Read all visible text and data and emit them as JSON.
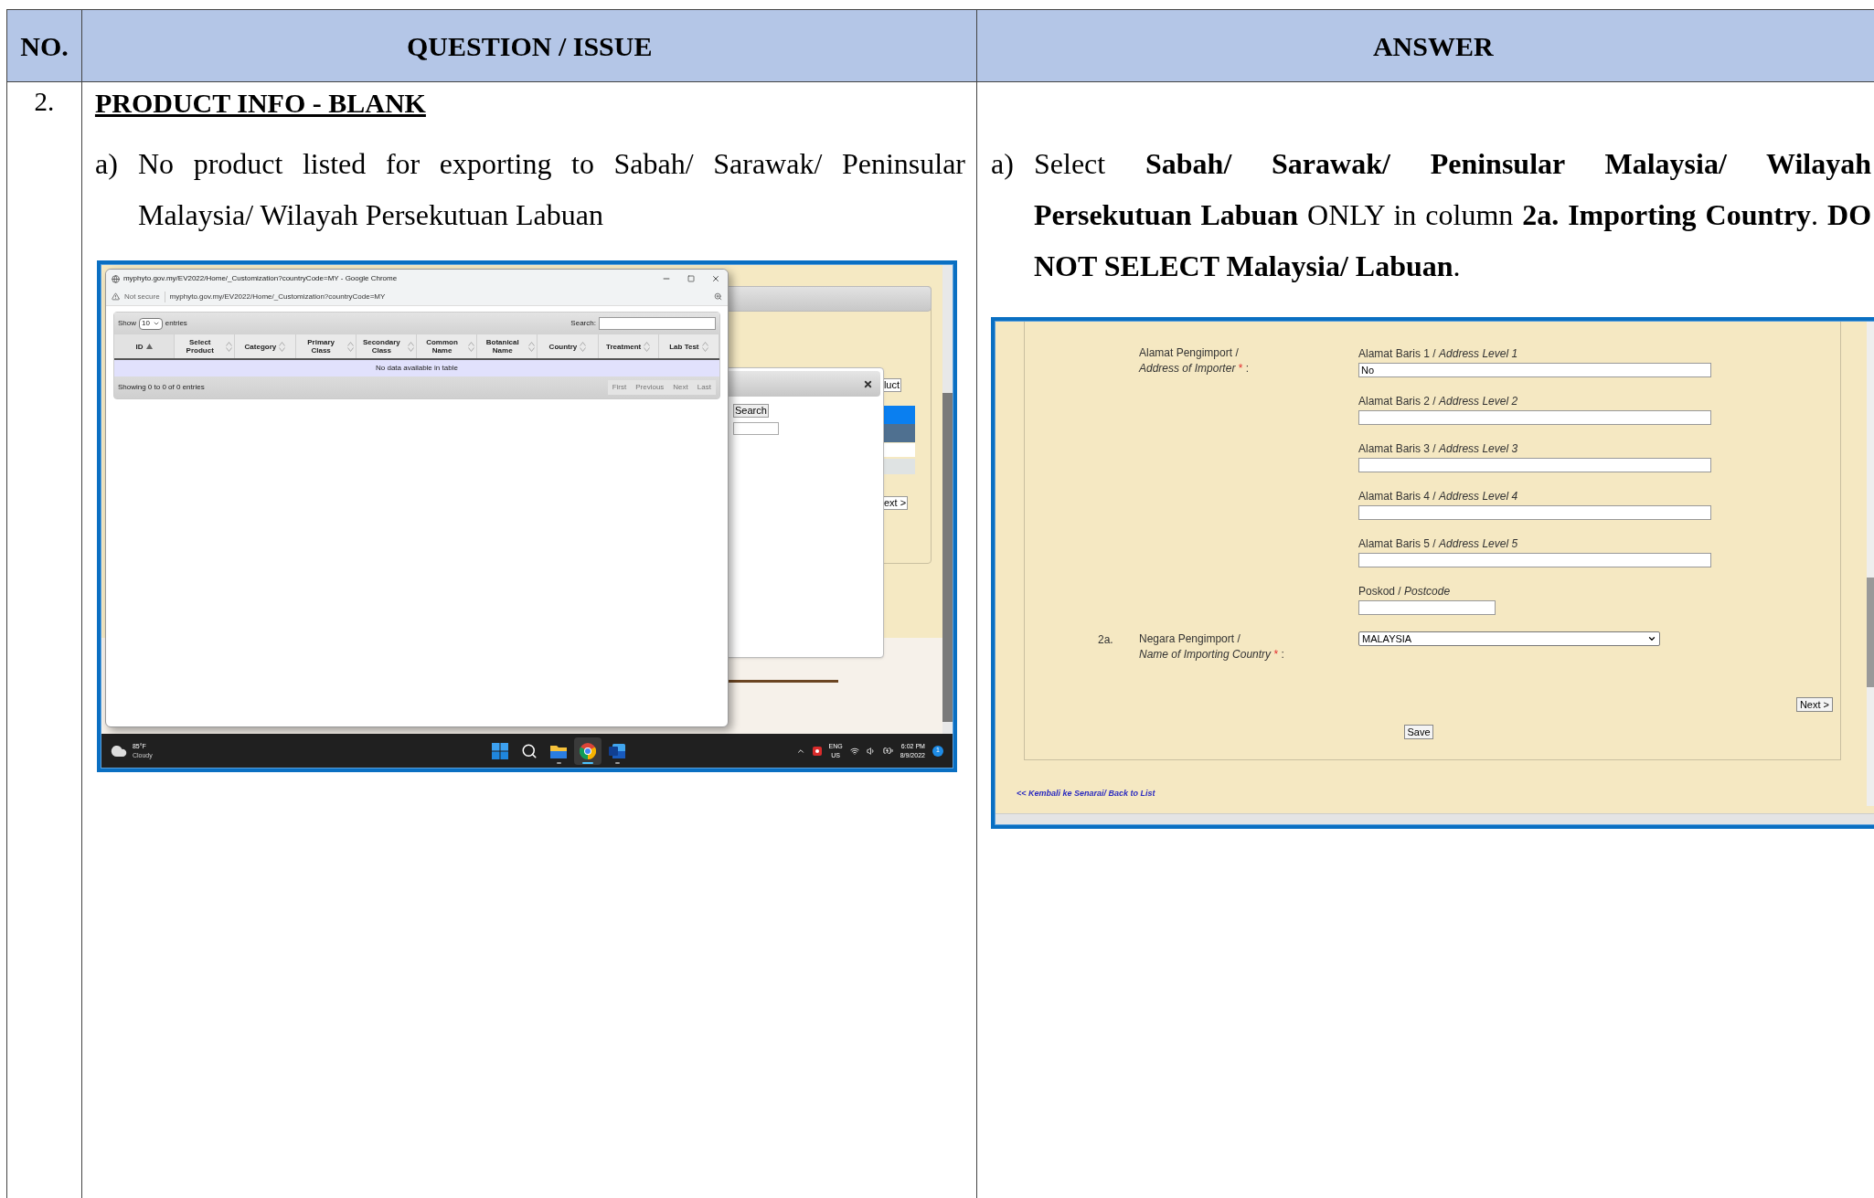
{
  "table": {
    "columns": [
      "NO.",
      "QUESTION / ISSUE",
      "ANSWER"
    ],
    "rows": [
      {
        "no": "2.",
        "title": "PRODUCT INFO - BLANK",
        "issue": {
          "marker": "a)",
          "text": "No product listed for exporting to Sabah/ Sarawak/ Peninsular Malaysia/ Wilayah Persekutuan Labuan",
          "screenshot": {
            "browser": {
              "title": "myphyto.gov.my/EV2022/Home/_Customization?countryCode=MY - Google Chrome",
              "security": "Not secure",
              "url": "myphyto.gov.my/EV2022/Home/_Customization?countryCode=MY"
            },
            "list": {
              "show_label": "Show",
              "page_size": "10",
              "entries_label": "entries",
              "search_label": "Search:",
              "columns": [
                {
                  "label": "ID",
                  "sorted": true
                },
                {
                  "label": "Select Product",
                  "sorted": false
                },
                {
                  "label": "Category",
                  "sorted": false
                },
                {
                  "label": "Primary Class",
                  "sorted": false
                },
                {
                  "label": "Secondary Class",
                  "sorted": false
                },
                {
                  "label": "Common Name",
                  "sorted": false
                },
                {
                  "label": "Botanical Name",
                  "sorted": false
                },
                {
                  "label": "Country",
                  "sorted": false
                },
                {
                  "label": "Treatment",
                  "sorted": false
                },
                {
                  "label": "Lab Test",
                  "sorted": false
                }
              ],
              "empty_message": "No data available in table",
              "info": "Showing 0 to 0 of 0 entries",
              "pager": [
                {
                  "label": "First",
                  "disabled": true
                },
                {
                  "label": "Previous",
                  "disabled": true
                },
                {
                  "label": "Next",
                  "disabled": true
                },
                {
                  "label": "Last",
                  "disabled": true
                }
              ]
            },
            "behind": {
              "search_button": "Search",
              "partial_button": "luct",
              "next_button": "ext >"
            },
            "taskbar": {
              "temperature": "85°F",
              "condition": "Cloudy",
              "apps": [
                {
                  "kind": "start",
                  "running": false,
                  "selected": false
                },
                {
                  "kind": "search",
                  "running": false,
                  "selected": false
                },
                {
                  "kind": "folder",
                  "running": true,
                  "selected": false
                },
                {
                  "kind": "browser",
                  "running": true,
                  "selected": true
                },
                {
                  "kind": "document",
                  "running": true,
                  "selected": false
                }
              ],
              "language": "ENG",
              "region": "US",
              "time": "6:02 PM",
              "date": "8/9/2022",
              "notifications": "1"
            }
          }
        },
        "answer": {
          "marker": "a)",
          "text": "Select **Sabah/ Sarawak/ Peninsular Malaysia/ Wilayah Persekutuan Labuan** ONLY in column **2a. Importing Country**. **DO NOT SELECT Malaysia/ Labuan**.",
          "screenshot": {
            "importer_label": "Alamat Pengimport /",
            "importer_label_en": "Address of Importer",
            "required_mark": "*",
            "colon": ":",
            "fields": [
              {
                "label": "Alamat Baris 1 / *Address Level 1*",
                "value": "No"
              },
              {
                "label": "Alamat Baris 2 / *Address Level 2*"
              },
              {
                "label": "Alamat Baris 3 / *Address Level 3*"
              },
              {
                "label": "Alamat Baris 4 / *Address Level 4*"
              },
              {
                "label": "Alamat Baris 5 / *Address Level 5*"
              }
            ],
            "postcode": {
              "label": "Poskod / *Postcode*"
            },
            "country": {
              "number": "2a.",
              "label": "Negara Pengimport /",
              "label_en": "Name of Importing Country",
              "required_mark": "*",
              "colon": ":",
              "value": "MALAYSIA"
            },
            "next_button": "Next >",
            "save_button": "Save",
            "back_link": "<< Kembali ke Senarai/ Back to List"
          }
        }
      }
    ]
  }
}
